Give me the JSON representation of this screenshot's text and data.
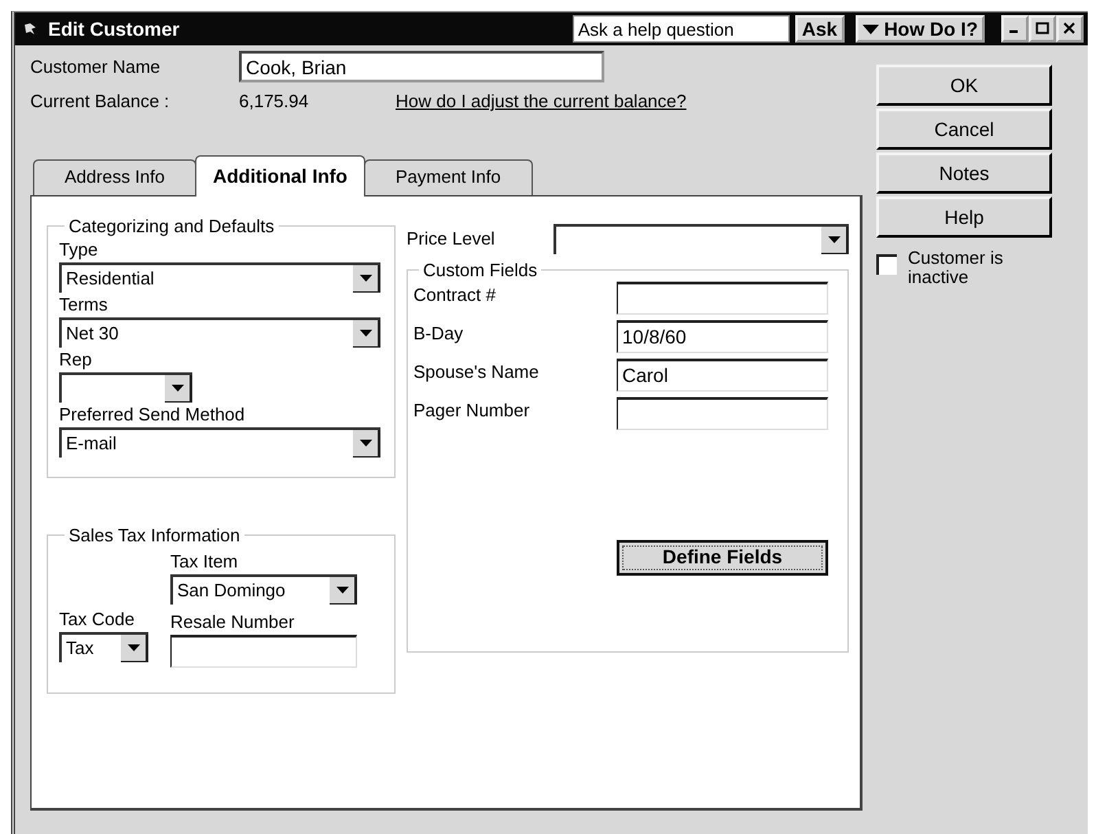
{
  "window": {
    "title": "Edit Customer"
  },
  "help": {
    "question": "Ask a help question",
    "ask_button": "Ask",
    "how_do_i": "How Do I?"
  },
  "customer_name": {
    "label": "Customer Name",
    "value": "Cook, Brian"
  },
  "current_balance": {
    "label": "Current Balance :",
    "value": "6,175.94",
    "link": "How do I adjust the current balance?"
  },
  "tabs": [
    {
      "label": "Address Info",
      "selected": false
    },
    {
      "label": "Additional Info",
      "selected": true
    },
    {
      "label": "Payment Info",
      "selected": false
    }
  ],
  "categorizing": {
    "title": "Categorizing and Defaults",
    "fields": [
      {
        "label": "Type",
        "value": "Residential"
      },
      {
        "label": "Terms",
        "value": "Net 30"
      },
      {
        "label": "Rep"
      },
      {
        "label": "Preferred Send Method",
        "value": "E-mail"
      }
    ]
  },
  "sales_tax": {
    "title": "Sales Tax Information",
    "tax_item": {
      "label": "Tax Item",
      "value": "San Domingo"
    },
    "tax_code": {
      "label": "Tax Code",
      "value": "Tax"
    },
    "resale_number": {
      "label": "Resale Number"
    }
  },
  "price_level": {
    "label": "Price Level"
  },
  "custom_fields": {
    "title": "Custom Fields",
    "fields": [
      {
        "label": "Contract #"
      },
      {
        "label": "B-Day",
        "value": "10/8/60"
      },
      {
        "label": "Spouse's Name",
        "value": "Carol"
      },
      {
        "label": "Pager Number"
      }
    ],
    "button": "Define Fields"
  },
  "buttons": [
    "OK",
    "Cancel",
    "Notes",
    "Help"
  ],
  "inactive": {
    "label": "Customer is inactive",
    "checked": false
  }
}
